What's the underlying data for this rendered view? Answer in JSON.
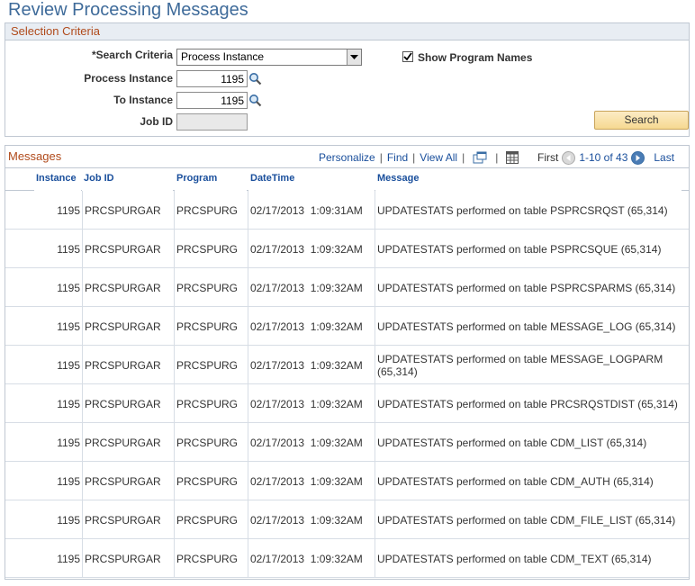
{
  "page": {
    "title": "Review Processing Messages"
  },
  "criteria": {
    "header": "Selection Criteria",
    "search_criteria_label": "*Search Criteria",
    "search_criteria_value": "Process Instance",
    "process_instance_label": "Process Instance",
    "process_instance_value": "1195",
    "to_instance_label": "To Instance",
    "to_instance_value": "1195",
    "job_id_label": "Job ID",
    "job_id_value": "",
    "show_program_names_label": "Show Program Names",
    "show_program_names_checked": true,
    "search_button": "Search"
  },
  "grid": {
    "title": "Messages",
    "tools": {
      "personalize": "Personalize",
      "find": "Find",
      "view_all": "View All"
    },
    "pager": {
      "first": "First",
      "range": "1-10 of 43",
      "last": "Last"
    },
    "columns": [
      "Instance",
      "Job ID",
      "Program",
      "DateTime",
      "Message"
    ],
    "rows": [
      {
        "instance": "1195",
        "job_id": "PRCSPURGAR",
        "program": "PRCSPURG",
        "datetime": "02/17/2013  1:09:31AM",
        "message": "UPDATESTATS performed on table PSPRCSRQST (65,314)"
      },
      {
        "instance": "1195",
        "job_id": "PRCSPURGAR",
        "program": "PRCSPURG",
        "datetime": "02/17/2013  1:09:32AM",
        "message": "UPDATESTATS performed on table PSPRCSQUE (65,314)"
      },
      {
        "instance": "1195",
        "job_id": "PRCSPURGAR",
        "program": "PRCSPURG",
        "datetime": "02/17/2013  1:09:32AM",
        "message": "UPDATESTATS performed on table PSPRCSPARMS (65,314)"
      },
      {
        "instance": "1195",
        "job_id": "PRCSPURGAR",
        "program": "PRCSPURG",
        "datetime": "02/17/2013  1:09:32AM",
        "message": "UPDATESTATS performed on table MESSAGE_LOG (65,314)"
      },
      {
        "instance": "1195",
        "job_id": "PRCSPURGAR",
        "program": "PRCSPURG",
        "datetime": "02/17/2013  1:09:32AM",
        "message": "UPDATESTATS performed on table MESSAGE_LOGPARM (65,314)"
      },
      {
        "instance": "1195",
        "job_id": "PRCSPURGAR",
        "program": "PRCSPURG",
        "datetime": "02/17/2013  1:09:32AM",
        "message": "UPDATESTATS performed on table PRCSRQSTDIST (65,314)"
      },
      {
        "instance": "1195",
        "job_id": "PRCSPURGAR",
        "program": "PRCSPURG",
        "datetime": "02/17/2013  1:09:32AM",
        "message": "UPDATESTATS performed on table CDM_LIST (65,314)"
      },
      {
        "instance": "1195",
        "job_id": "PRCSPURGAR",
        "program": "PRCSPURG",
        "datetime": "02/17/2013  1:09:32AM",
        "message": "UPDATESTATS performed on table CDM_AUTH (65,314)"
      },
      {
        "instance": "1195",
        "job_id": "PRCSPURGAR",
        "program": "PRCSPURG",
        "datetime": "02/17/2013  1:09:32AM",
        "message": "UPDATESTATS performed on table CDM_FILE_LIST (65,314)"
      },
      {
        "instance": "1195",
        "job_id": "PRCSPURGAR",
        "program": "PRCSPURG",
        "datetime": "02/17/2013  1:09:32AM",
        "message": "UPDATESTATS performed on table CDM_TEXT (65,314)"
      }
    ]
  },
  "colors": {
    "title": "#3f6b9a",
    "section_header": "#b04a1b",
    "link": "#1a4f9c",
    "border": "#c0c8d2"
  }
}
